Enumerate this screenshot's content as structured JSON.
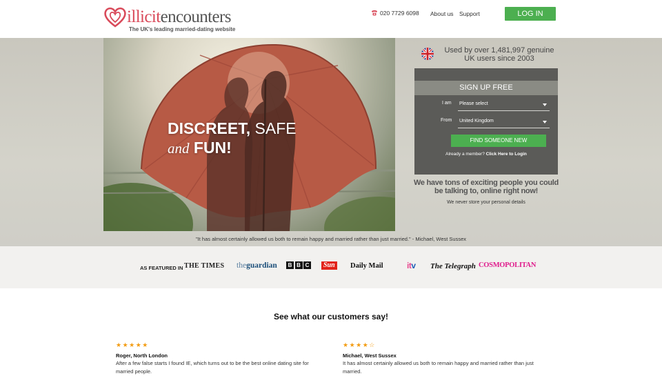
{
  "header": {
    "logo_word_1": "illicit",
    "logo_word_2": "encounters",
    "tagline": "The UK's leading married-dating website",
    "phone": "020 7729 6098",
    "nav": [
      "About us",
      "Support"
    ],
    "login_label": "LOG IN"
  },
  "hero": {
    "headline_1a": "DISCREET,",
    "headline_1b": " SAFE",
    "headline_2a": "and",
    "headline_2b": " FUN!",
    "stats_text": "Used by over 1,481,997 genuine UK users since 2003",
    "signup": {
      "title": "SIGN UP FREE",
      "iam_label": "I am",
      "iam_value": "Please select",
      "from_label": "From",
      "from_value": "United Kingdom",
      "cta": "FIND SOMEONE NEW",
      "member_text": "Already a member?",
      "member_link": "Click Here to Login"
    },
    "tons_text": "We have tons of exciting people you could be talking to, online right now!",
    "privacy_note": "We never store your personal details",
    "quote": "\"It has almost certainly allowed us both to remain happy and married rather than just married.\" - Michael, West Sussex"
  },
  "featured": {
    "label": "AS FEATURED IN",
    "times": "THE TIMES",
    "guardian_the": "the",
    "guardian": "guardian",
    "bbc": [
      "B",
      "B",
      "C"
    ],
    "sun": "Sun",
    "mail": "Daily Mail",
    "itv_a": "it",
    "itv_b": "v",
    "telegraph": "The Telegraph",
    "cosmo": "COSMOPOLITAN"
  },
  "testimonials": {
    "title": "See what our customers say!",
    "items": [
      {
        "stars": "★★★★★",
        "name": "Roger, North London",
        "text": "After a few false starts I found IE, which turns out to be the best online dating site for married people."
      },
      {
        "stars": "★★★★☆",
        "name": "Michael, West Sussex",
        "text": "It has almost certainly allowed us both to remain happy and married rather than just married."
      }
    ]
  },
  "colors": {
    "accent_green": "#4caf50",
    "brand_red": "#d94a5a",
    "panel_grey": "#5b5b58",
    "star_orange": "#f39c12"
  },
  "icons": [
    "heart-logo-icon",
    "phone-icon",
    "uk-flag-icon",
    "caret-down-icon"
  ]
}
